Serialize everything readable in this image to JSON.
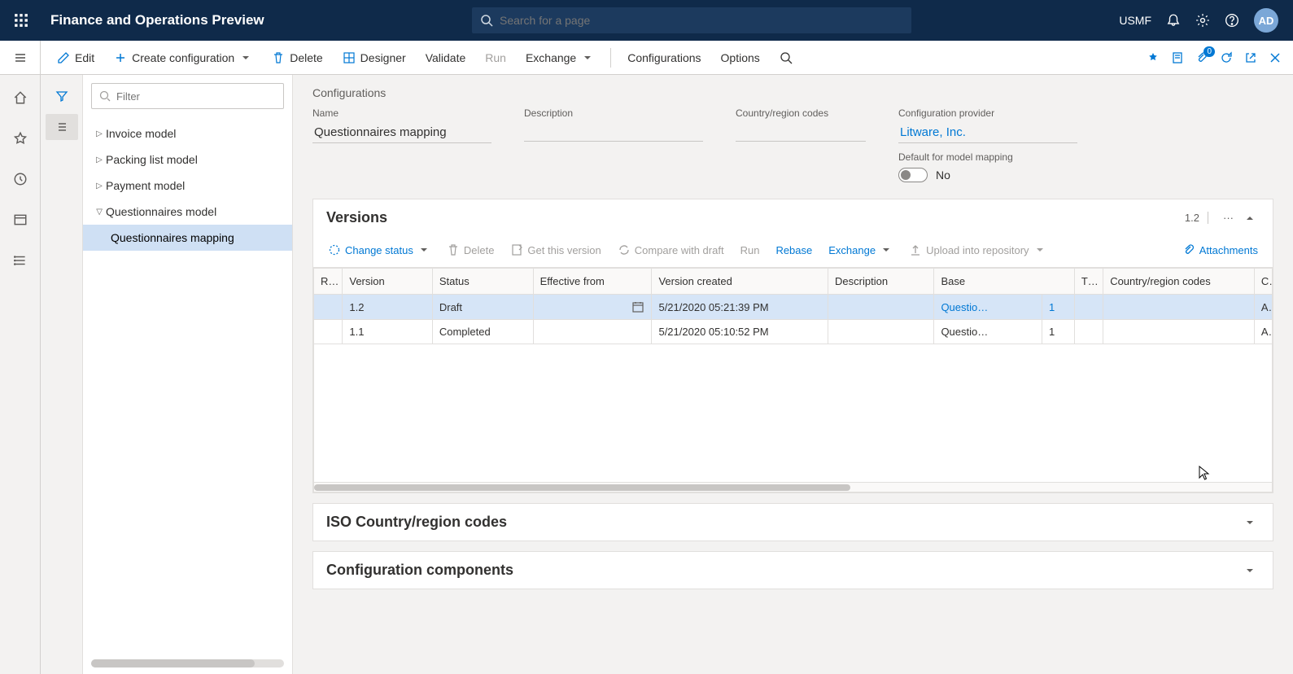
{
  "header": {
    "app_title": "Finance and Operations Preview",
    "search_placeholder": "Search for a page",
    "company": "USMF",
    "avatar": "AD"
  },
  "command_bar": {
    "edit": "Edit",
    "create": "Create configuration",
    "delete": "Delete",
    "designer": "Designer",
    "validate": "Validate",
    "run": "Run",
    "exchange": "Exchange",
    "configurations": "Configurations",
    "options": "Options",
    "attach_badge": "0"
  },
  "tree": {
    "filter_placeholder": "Filter",
    "nodes": {
      "n0": "Invoice model",
      "n1": "Packing list model",
      "n2": "Payment model",
      "n3": "Questionnaires model",
      "n3_0": "Questionnaires mapping"
    }
  },
  "content": {
    "breadcrumb": "Configurations",
    "fields": {
      "name_label": "Name",
      "name_value": "Questionnaires mapping",
      "desc_label": "Description",
      "desc_value": "",
      "country_label": "Country/region codes",
      "country_value": "",
      "provider_label": "Configuration provider",
      "provider_value": "Litware, Inc.",
      "default_label": "Default for model mapping",
      "default_value": "No"
    },
    "versions": {
      "title": "Versions",
      "badge": "1.2",
      "toolbar": {
        "change_status": "Change status",
        "delete": "Delete",
        "get_version": "Get this version",
        "compare": "Compare with draft",
        "run": "Run",
        "rebase": "Rebase",
        "exchange": "Exchange",
        "upload": "Upload into repository",
        "attachments": "Attachments"
      },
      "columns": {
        "c0": "R…",
        "c1": "Version",
        "c2": "Status",
        "c3": "Effective from",
        "c4": "Version created",
        "c5": "Description",
        "c6": "Base",
        "c7": "T…",
        "c8": "Country/region codes",
        "c9": "C"
      },
      "rows": [
        {
          "version": "1.2",
          "status": "Draft",
          "effective": "",
          "created": "5/21/2020 05:21:39 PM",
          "desc": "",
          "base": "Questio…",
          "base_n": "1",
          "t": "",
          "country": "",
          "c": "A"
        },
        {
          "version": "1.1",
          "status": "Completed",
          "effective": "",
          "created": "5/21/2020 05:10:52 PM",
          "desc": "",
          "base": "Questio…",
          "base_n": "1",
          "t": "",
          "country": "",
          "c": "A"
        }
      ]
    },
    "iso_section": "ISO Country/region codes",
    "components_section": "Configuration components"
  }
}
